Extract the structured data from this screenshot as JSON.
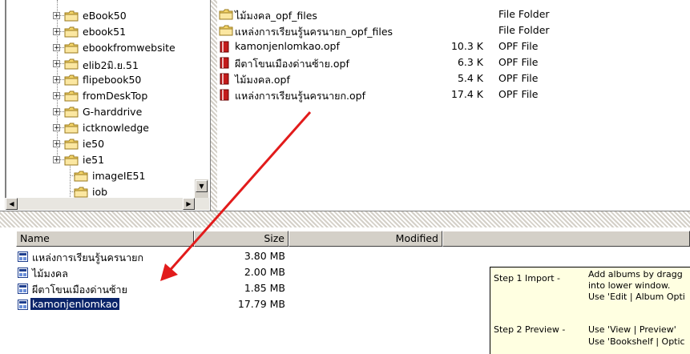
{
  "tree": {
    "items": [
      {
        "label": "eBook50",
        "expandable": true
      },
      {
        "label": "ebook51",
        "expandable": true
      },
      {
        "label": "ebookfromwebsite",
        "expandable": true
      },
      {
        "label": "elib2มิ.ย.51",
        "expandable": true
      },
      {
        "label": "flipebook50",
        "expandable": true
      },
      {
        "label": "fromDeskTop",
        "expandable": true
      },
      {
        "label": "G-harddrive",
        "expandable": true
      },
      {
        "label": "ictknowledge",
        "expandable": true
      },
      {
        "label": "ie50",
        "expandable": true
      },
      {
        "label": "ie51",
        "expandable": true
      },
      {
        "label": "imageIE51",
        "expandable": false
      },
      {
        "label": "iob",
        "expandable": false
      }
    ]
  },
  "files": [
    {
      "name": "ไม้มงคล_opf_files",
      "size": "",
      "type": "File Folder",
      "icon": "folder-icon"
    },
    {
      "name": "แหล่งการเรียนรู้นครนายก_opf_files",
      "size": "",
      "type": "File Folder",
      "icon": "folder-icon"
    },
    {
      "name": "kamonjenlomkao.opf",
      "size": "10.3 K",
      "type": "OPF File",
      "icon": "opf-file-icon"
    },
    {
      "name": "ผีตาโขนเมืองด่านซ้าย.opf",
      "size": "6.3 K",
      "type": "OPF File",
      "icon": "opf-file-icon"
    },
    {
      "name": "ไม้มงคล.opf",
      "size": "5.4 K",
      "type": "OPF File",
      "icon": "opf-file-icon"
    },
    {
      "name": "แหล่งการเรียนรู้นครนายก.opf",
      "size": "17.4 K",
      "type": "OPF File",
      "icon": "opf-file-icon"
    }
  ],
  "albums": {
    "headers": {
      "name": "Name",
      "size": "Size",
      "modified": "Modified"
    },
    "rows": [
      {
        "name": "แหล่งการเรียนรู้นครนายก",
        "size": "3.80 MB",
        "selected": false
      },
      {
        "name": "ไม้มงคล",
        "size": "2.00 MB",
        "selected": false
      },
      {
        "name": "ผีตาโขนเมืองด่านซ้าย",
        "size": "1.85 MB",
        "selected": false
      },
      {
        "name": "kamonjenlomkao",
        "size": "17.79 MB",
        "selected": true
      }
    ]
  },
  "help": {
    "step1": {
      "label": "Step 1 Import -",
      "lines": [
        "Add albums by dragg",
        "into lower window.",
        "Use 'Edit | Album Opti"
      ]
    },
    "step2": {
      "label": "Step 2 Preview -",
      "lines": [
        "Use 'View | Preview'",
        "Use 'Bookshelf | Optic"
      ]
    }
  },
  "colors": {
    "selection": "#0a246a",
    "arrow": "#e21b1b",
    "folder": "#f5d66b",
    "help_bg": "#ffffe1"
  }
}
